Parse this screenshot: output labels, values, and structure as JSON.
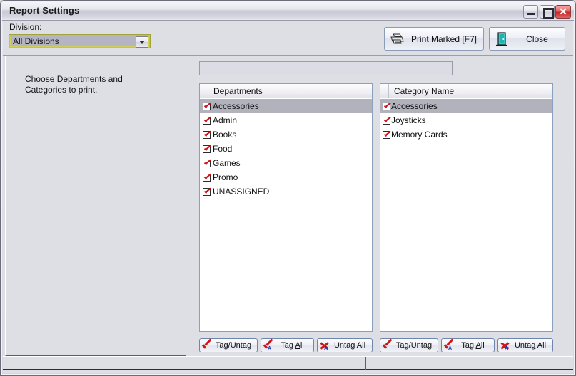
{
  "window": {
    "title": "Report Settings",
    "caption_buttons": [
      {
        "name": "minimize",
        "glyph": ""
      },
      {
        "name": "maximize",
        "glyph": ""
      },
      {
        "name": "close",
        "glyph": "✕"
      }
    ]
  },
  "toolbar": {
    "division_label": "Division:",
    "division_value": "All Divisions",
    "division_options": [
      "All Divisions"
    ],
    "print_button": "Print Marked [F7]",
    "close_button": "Close"
  },
  "left_pane": {
    "hint": "Choose Departments and\nCategories to print."
  },
  "filter": {
    "value": "",
    "placeholder": ""
  },
  "departments": {
    "header": "Departments",
    "rows": [
      {
        "label": "Accessories",
        "checked": true,
        "selected": true
      },
      {
        "label": "Admin",
        "checked": true,
        "selected": false
      },
      {
        "label": "Books",
        "checked": true,
        "selected": false
      },
      {
        "label": "Food",
        "checked": true,
        "selected": false
      },
      {
        "label": "Games",
        "checked": true,
        "selected": false
      },
      {
        "label": "Promo",
        "checked": true,
        "selected": false
      },
      {
        "label": "UNASSIGNED",
        "checked": true,
        "selected": false
      }
    ]
  },
  "categories": {
    "header": "Category Name",
    "rows": [
      {
        "label": "Accessories",
        "checked": true,
        "selected": true
      },
      {
        "label": "Joysticks",
        "checked": true,
        "selected": false
      },
      {
        "label": "Memory Cards",
        "checked": true,
        "selected": false
      }
    ]
  },
  "tag_buttons_left": [
    {
      "label": "Tag/Untag",
      "icon": "red-check-icon"
    },
    {
      "label_a": "Tag ",
      "label_u": "A",
      "label_b": "ll",
      "icon": "red-check-a-icon"
    },
    {
      "label_a": "Unta",
      "label_u": "g",
      "label_b": " All",
      "icon": "red-x-a-icon"
    }
  ],
  "tag_buttons_right": [
    {
      "label": "Tag/Untag",
      "icon": "red-check-icon"
    },
    {
      "label_a": "Tag ",
      "label_u": "A",
      "label_b": "ll",
      "icon": "red-check-a-icon"
    },
    {
      "label_a": "Unta",
      "label_u": "g",
      "label_b": " All",
      "icon": "red-x-a-icon"
    }
  ],
  "icons": {
    "printer": "printer-icon",
    "door": "exit-door-icon",
    "tag_sub_letter": "A"
  },
  "colors": {
    "window_bg": "#dedee5",
    "titlebar_grad_top": "#f4f4f8",
    "close_red": "#c62828",
    "check_red": "#cc1111",
    "selection_gray": "#b2b2bd",
    "combo_border_yellow": "#cfcf5a",
    "combo_fill": "#b4b4c2",
    "door_teal": "#39c4c4"
  }
}
